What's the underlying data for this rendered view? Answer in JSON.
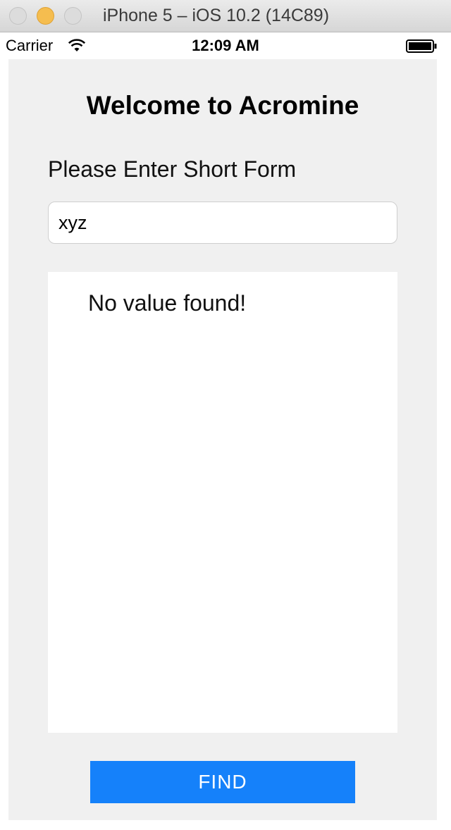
{
  "window": {
    "title": "iPhone 5 – iOS 10.2 (14C89)"
  },
  "status_bar": {
    "carrier": "Carrier",
    "time": "12:09 AM"
  },
  "app": {
    "title": "Welcome to Acromine",
    "prompt_label": "Please Enter Short Form",
    "input_value": "xyz",
    "result_text": "No value found!",
    "find_button_label": "FIND"
  },
  "colors": {
    "accent_button": "#1581fa",
    "screen_background": "#f0f0f0"
  }
}
